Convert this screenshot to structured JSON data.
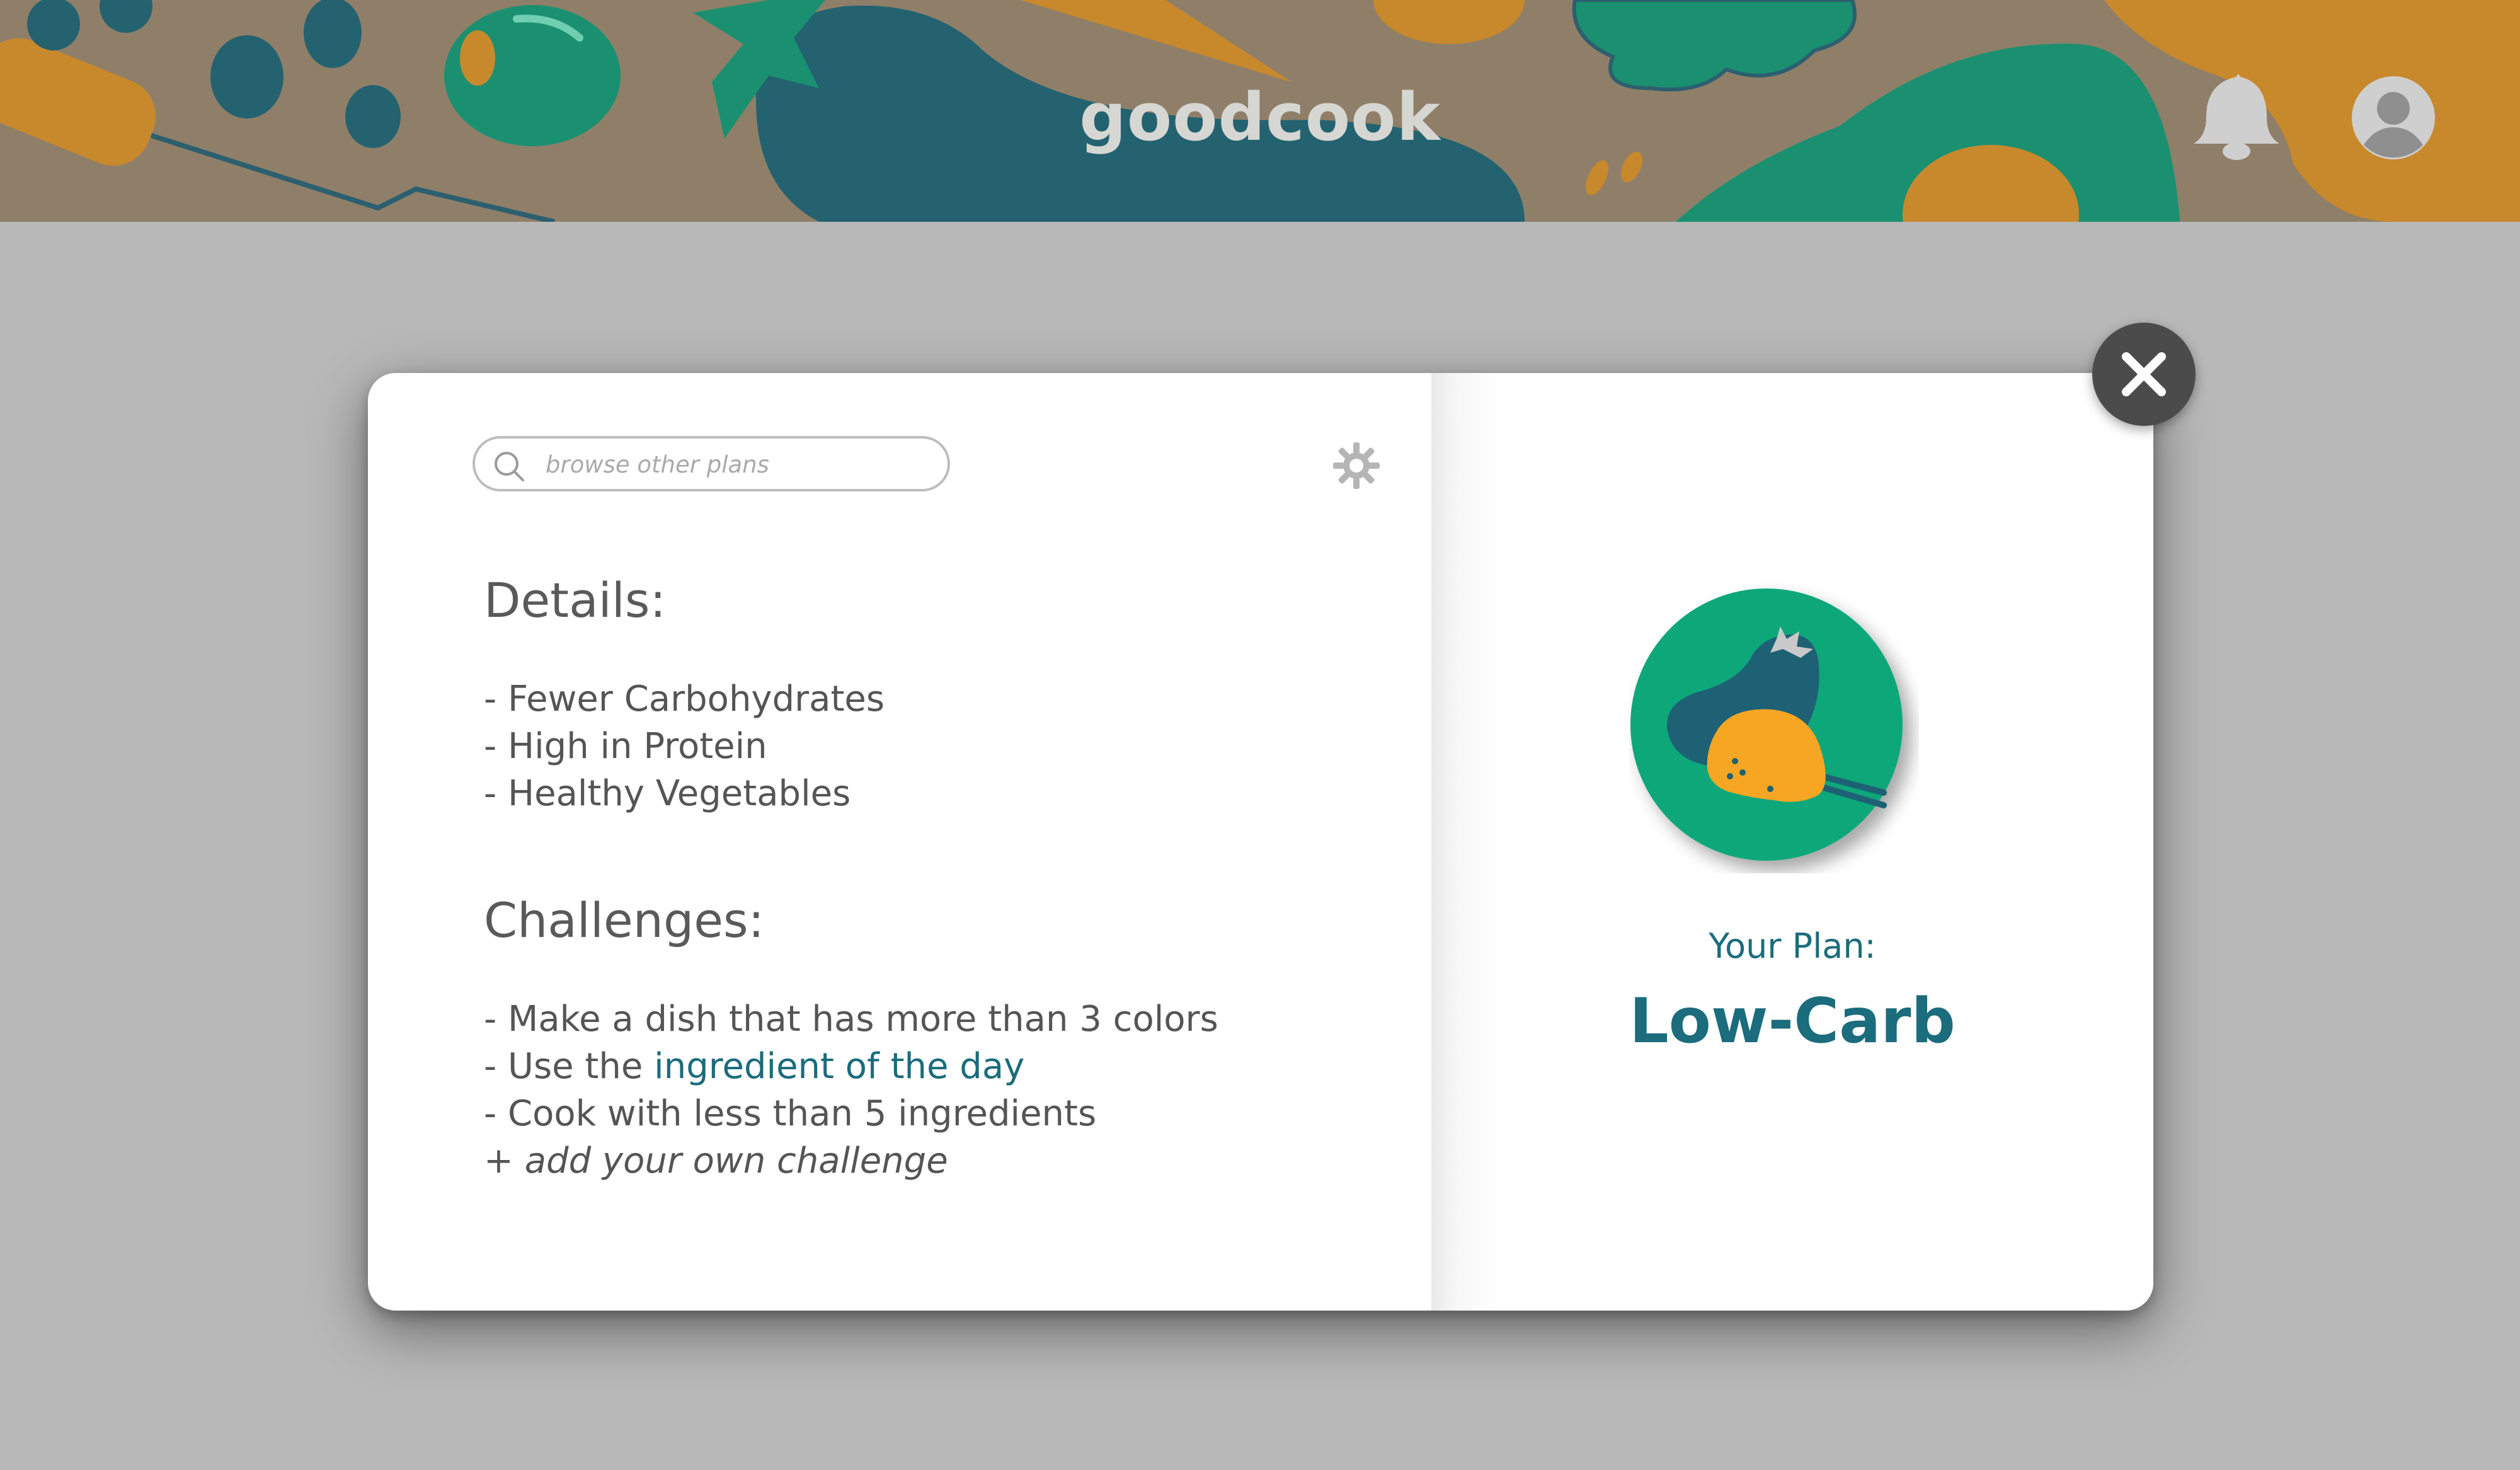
{
  "header": {
    "app_name": "goodcook",
    "notifications_icon": "bell-icon",
    "profile_icon": "user-avatar-icon"
  },
  "plan_modal": {
    "search": {
      "placeholder": "browse other plans",
      "value": ""
    },
    "settings_icon": "gear-icon",
    "close_icon": "close-icon",
    "details": {
      "title": "Details:",
      "items": [
        "- Fewer Carbohydrates",
        "- High in Protein",
        "- Healthy Vegetables"
      ]
    },
    "challenges": {
      "title": "Challenges:",
      "item1": "- Make a dish that has more than 3 colors",
      "item2_prefix": "- Use the ",
      "item2_link": "ingredient of the day",
      "item3": "- Cook with less than 5 ingredients",
      "add_label": "+ add your own challenge"
    },
    "plan": {
      "label": "Your Plan:",
      "name": "Low-Carb",
      "icon": "eggplant-and-chicken-icon"
    }
  },
  "colors": {
    "teal_text": "#1b6c7c",
    "header_bg": "#8f7f69",
    "page_bg": "#b7b8b7",
    "plan_circle": "#0aa77a",
    "accent_orange": "#f6a623"
  }
}
